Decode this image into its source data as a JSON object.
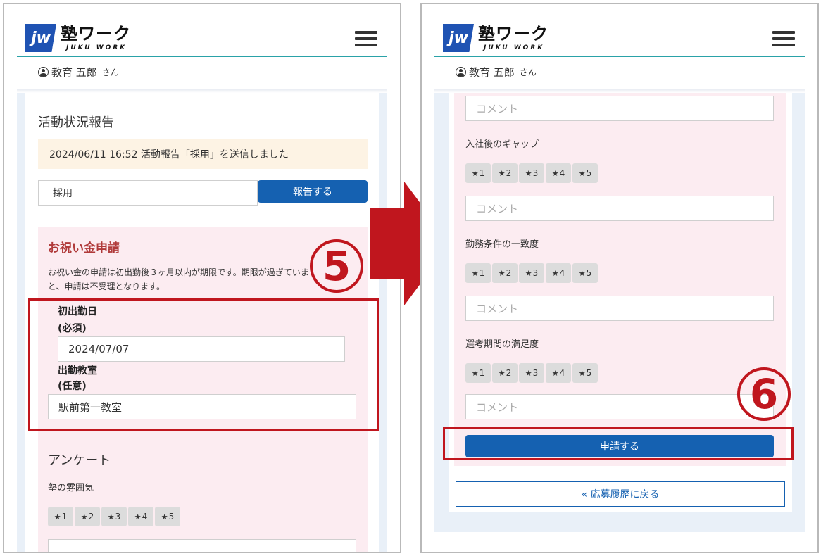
{
  "header": {
    "logo_mark": "jw",
    "logo_text": "塾ワーク",
    "logo_sub": "JUKU WORK",
    "menu_icon": "hamburger-icon",
    "user_icon": "user-circle-icon",
    "user_name": "教育 五郎",
    "user_suffix": "さん"
  },
  "left": {
    "section_title": "活動状況報告",
    "notice": "2024/06/11 16:52 活動報告「採用」を送信しました",
    "status_value": "採用",
    "report_button": "報告する",
    "bonus_title": "お祝い金申請",
    "bonus_desc_1": "お祝い金の申請は初出勤後３ヶ月以内が期限です。期限が過ぎていま",
    "bonus_desc_2": "と、申請は不受理となります。",
    "first_day_label": "初出勤日",
    "first_day_req": "(必須)",
    "first_day_value": "2024/07/07",
    "classroom_label": "出勤教室",
    "classroom_opt": "(任意)",
    "classroom_value": "駅前第一教室",
    "survey_title": "アンケート",
    "q1": "塾の雰囲気",
    "step_number": "5"
  },
  "right": {
    "comment_placeholder": "コメント",
    "q_gap": "入社後のギャップ",
    "q_conditions": "勤務条件の一致度",
    "q_selection": "選考期間の満足度",
    "apply_button": "申請する",
    "back_link": "« 応募履歴に戻る",
    "step_number": "6"
  },
  "stars": [
    "1",
    "2",
    "3",
    "4",
    "5"
  ],
  "colors": {
    "accent_blue": "#1561b1",
    "highlight_red": "#c0161e",
    "pink_bg": "#fcecf1",
    "notice_bg": "#fdf3e4",
    "bonus_title": "#b03a3a"
  }
}
